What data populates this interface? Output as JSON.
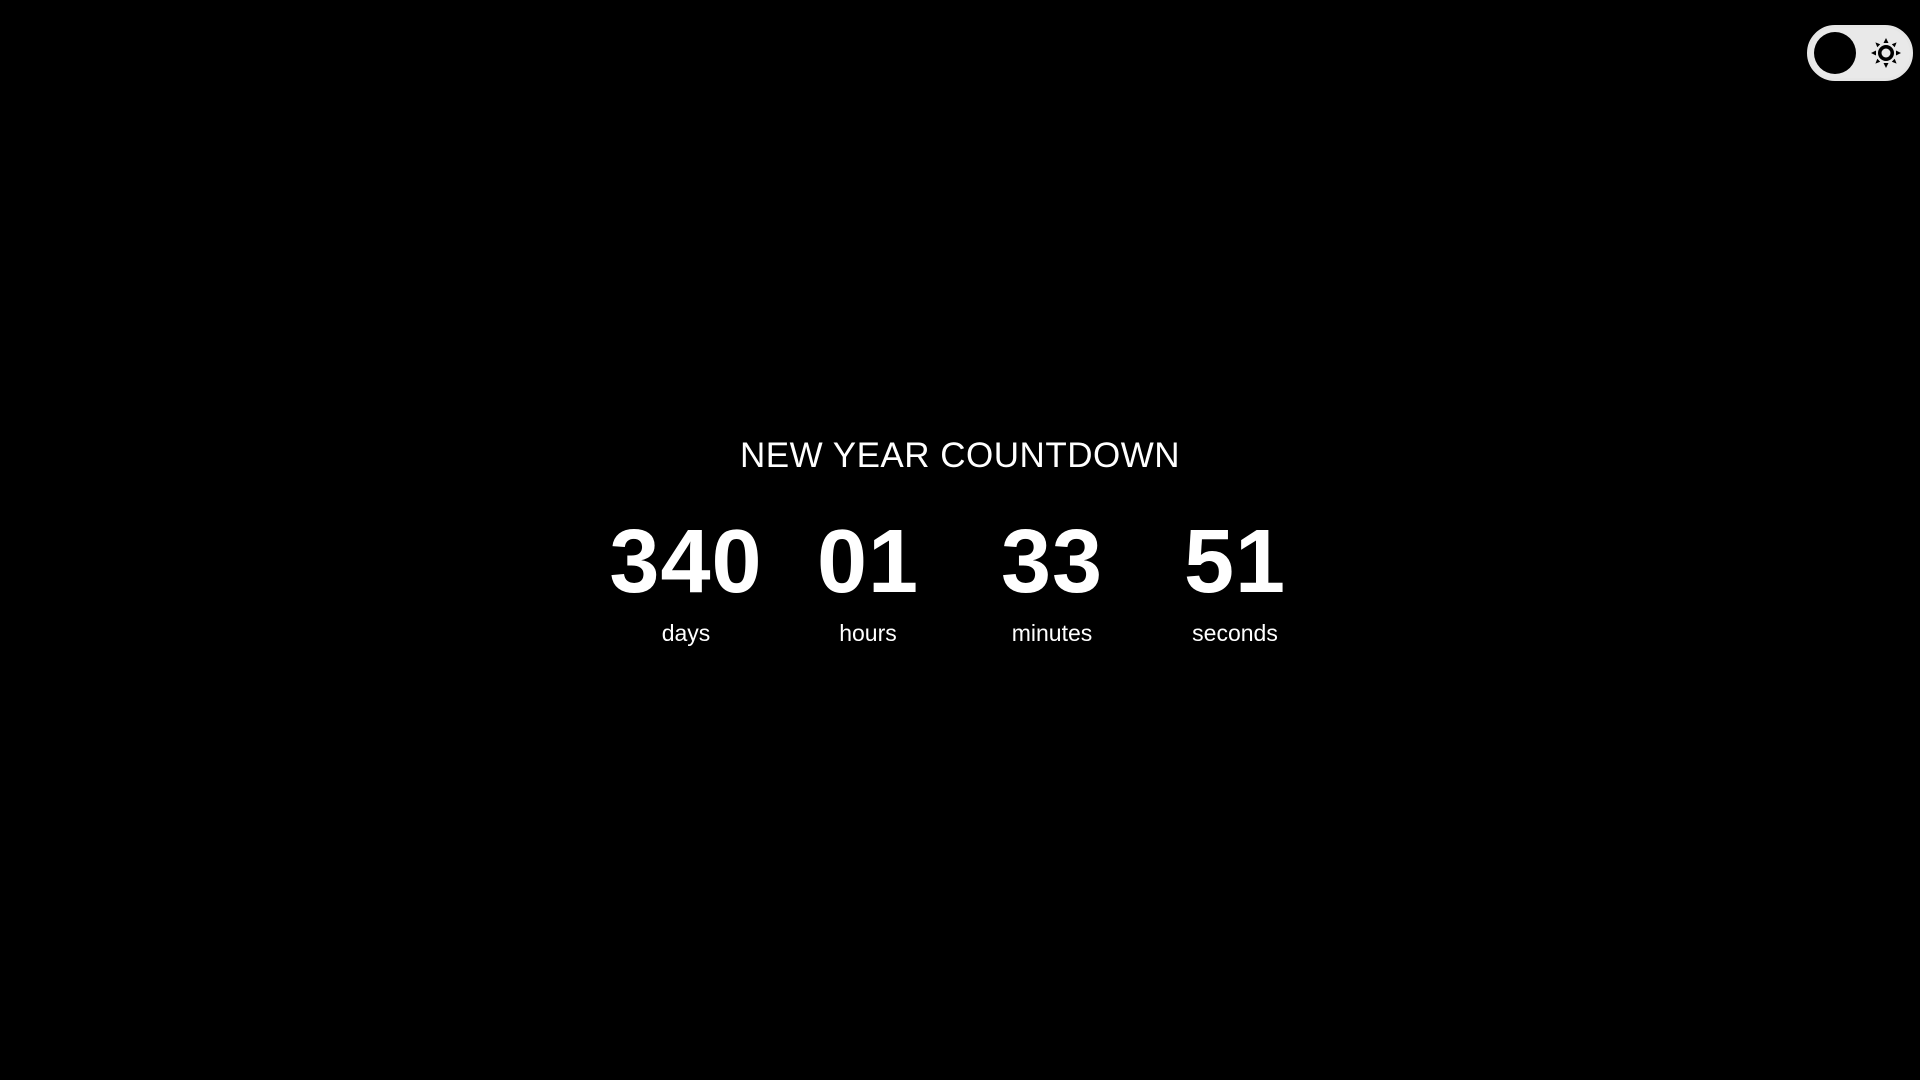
{
  "theme_toggle": {
    "icon": "sun-icon",
    "state": "dark"
  },
  "countdown": {
    "title": "NEW YEAR COUNTDOWN",
    "units": [
      {
        "value": "340",
        "label": "days"
      },
      {
        "value": "01",
        "label": "hours"
      },
      {
        "value": "33",
        "label": "minutes"
      },
      {
        "value": "51",
        "label": "seconds"
      }
    ]
  },
  "colors": {
    "background": "#000000",
    "text": "#ffffff",
    "toggle_track": "#e9e9e9",
    "toggle_knob": "#000000"
  }
}
